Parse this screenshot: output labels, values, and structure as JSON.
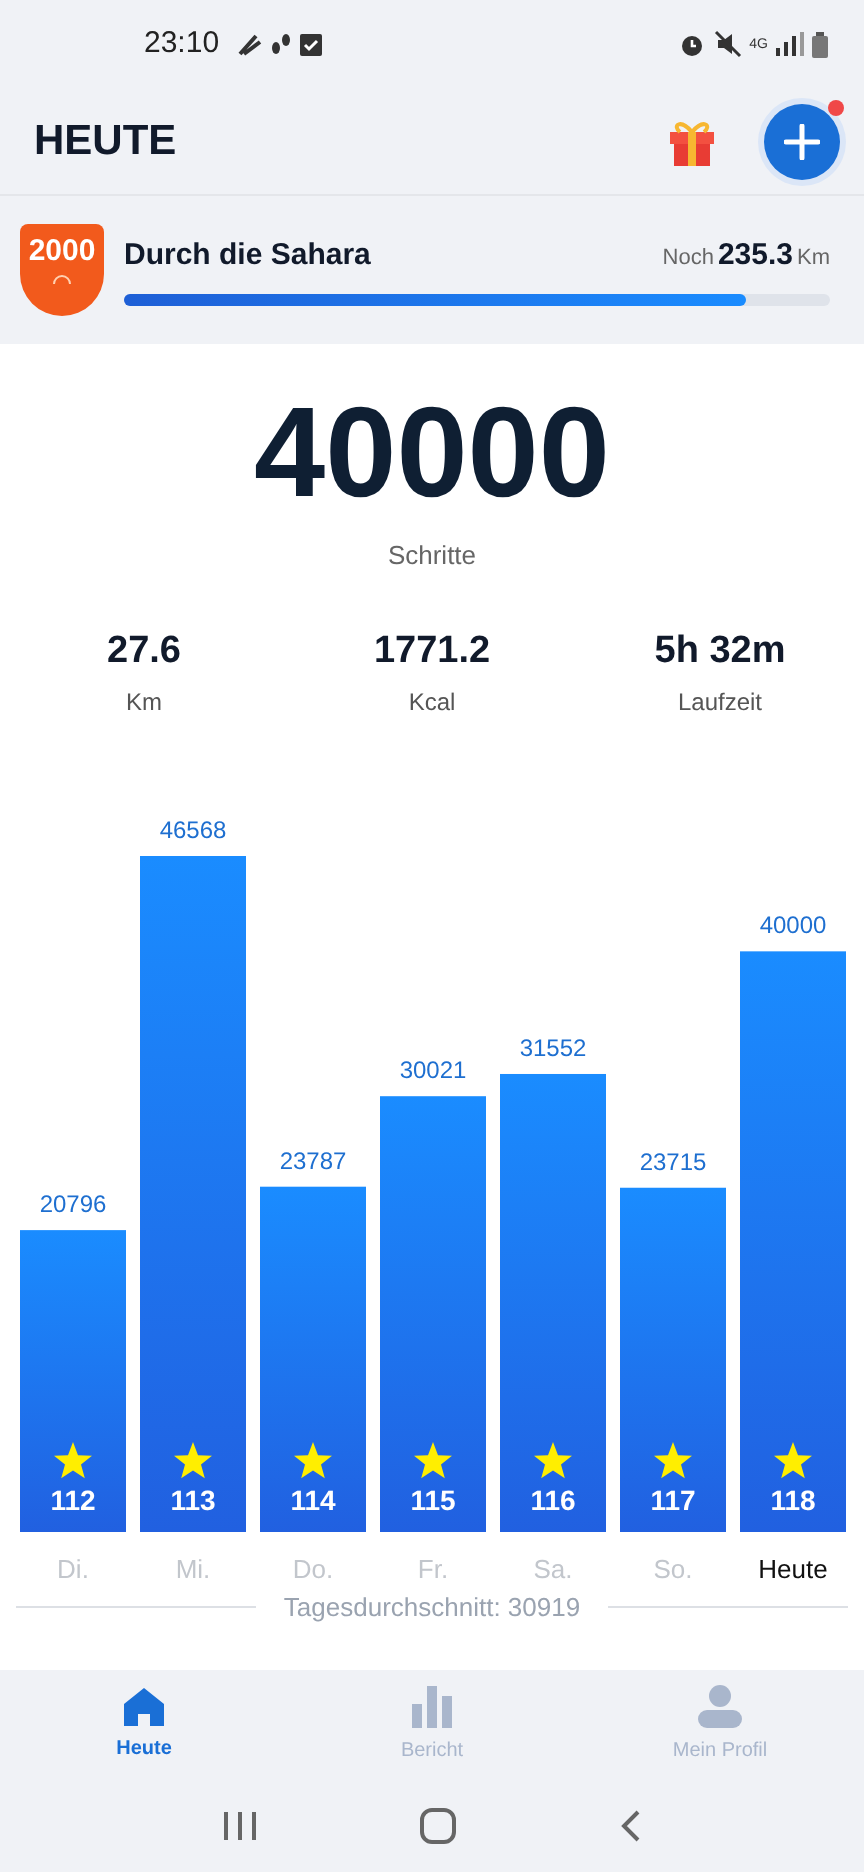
{
  "status_bar": {
    "time": "23:10",
    "network": "4G"
  },
  "header": {
    "title": "HEUTE",
    "notification_dot": true
  },
  "challenge": {
    "badge": "2000",
    "title": "Durch die Sahara",
    "remaining_label": "Noch",
    "remaining_value": "235.3",
    "unit": "Km",
    "level": 0.88
  },
  "today": {
    "steps": "40000",
    "steps_label": "Schritte"
  },
  "stats": [
    {
      "value": "27.6",
      "label": "Km"
    },
    {
      "value": "1771.2",
      "label": "Kcal"
    },
    {
      "value": "5h 32m",
      "label": "Laufzeit"
    }
  ],
  "chart_data": {
    "type": "bar",
    "categories": [
      "Di.",
      "Mi.",
      "Do.",
      "Fr.",
      "Sa.",
      "So.",
      "Heute"
    ],
    "values": [
      20796,
      46568,
      23787,
      30021,
      31552,
      23715,
      40000
    ],
    "data_labels": true
  },
  "days": [
    {
      "badge": "112",
      "selected": false
    },
    {
      "badge": "113",
      "selected": false
    },
    {
      "badge": "114",
      "selected": false
    },
    {
      "badge": "115",
      "selected": false
    },
    {
      "badge": "116",
      "selected": false
    },
    {
      "badge": "117",
      "selected": false
    },
    {
      "badge": "118",
      "selected": true
    }
  ],
  "average": "Tagesdurchschnitt: 30919",
  "nav": [
    {
      "label": "Heute",
      "kind": "home",
      "selected": true
    },
    {
      "label": "Bericht",
      "kind": "report",
      "selected": false
    },
    {
      "label": "Mein Profil",
      "kind": "profile",
      "selected": false
    }
  ]
}
